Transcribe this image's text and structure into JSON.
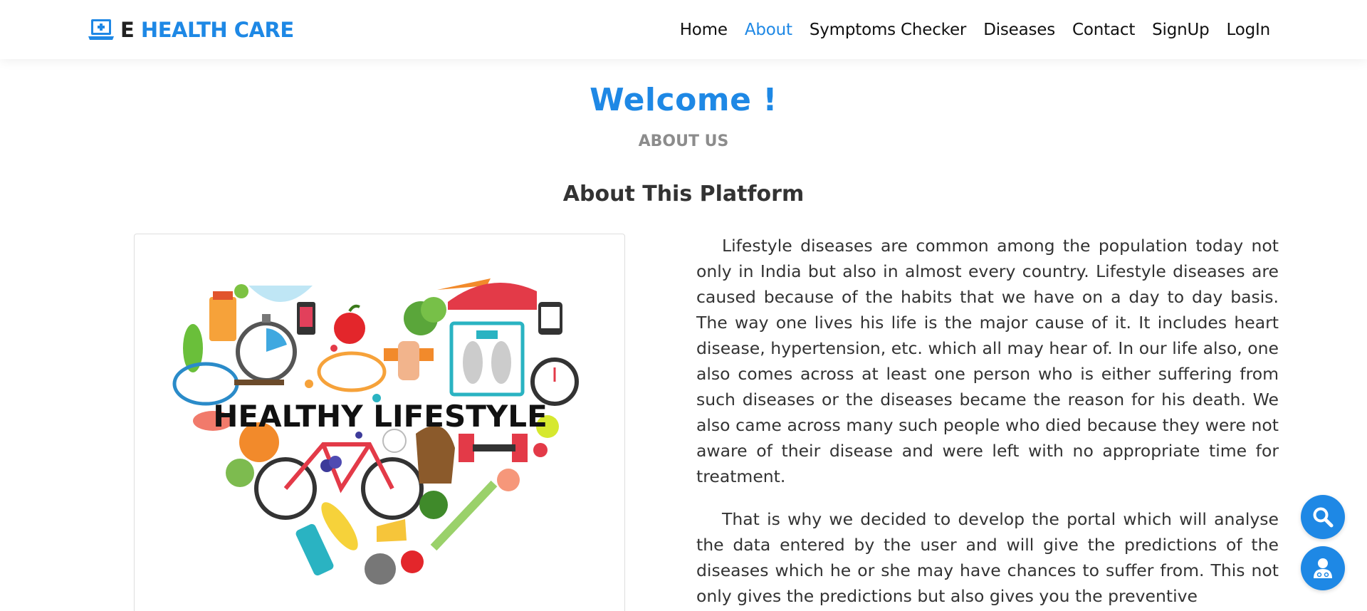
{
  "header": {
    "logo_e": "E",
    "logo_brand": "HEALTH CARE",
    "logo_icon": "laptop-medical-icon",
    "nav": [
      {
        "label": "Home",
        "active": false
      },
      {
        "label": "About",
        "active": true
      },
      {
        "label": "Symptoms Checker",
        "active": false
      },
      {
        "label": "Diseases",
        "active": false
      },
      {
        "label": "Contact",
        "active": false
      },
      {
        "label": "SignUp",
        "active": false
      },
      {
        "label": "LogIn",
        "active": false
      }
    ]
  },
  "hero": {
    "welcome": "Welcome !",
    "subtitle": "ABOUT US",
    "section_title": "About This Platform"
  },
  "image": {
    "caption_text": "HEALTHY LIFESTYLE"
  },
  "content": {
    "paragraphs": [
      "Lifestyle diseases are common among the population today not only in India but also in almost every country. Lifestyle diseases are caused because of the habits that we have on a day to day basis. The way one lives his life is the major cause of it. It includes heart disease, hypertension, etc. which all may hear of. In our life also, one also comes across at least one person who is either suffering from such diseases or the diseases became the reason for his death. We also came across many such people who died because they were not aware of their disease and were left with no appropriate time for treatment.",
      "That is why we decided to develop the portal which will analyse the data entered by the user and will give the predictions of the diseases which he or she may have chances to suffer from. This not only gives the predictions but also gives you the preventive"
    ]
  },
  "floating": {
    "search_icon": "search-icon",
    "doctor_icon": "doctor-icon"
  },
  "colors": {
    "accent": "#1e88e5",
    "muted": "#8c8c8c",
    "text": "#333333"
  }
}
